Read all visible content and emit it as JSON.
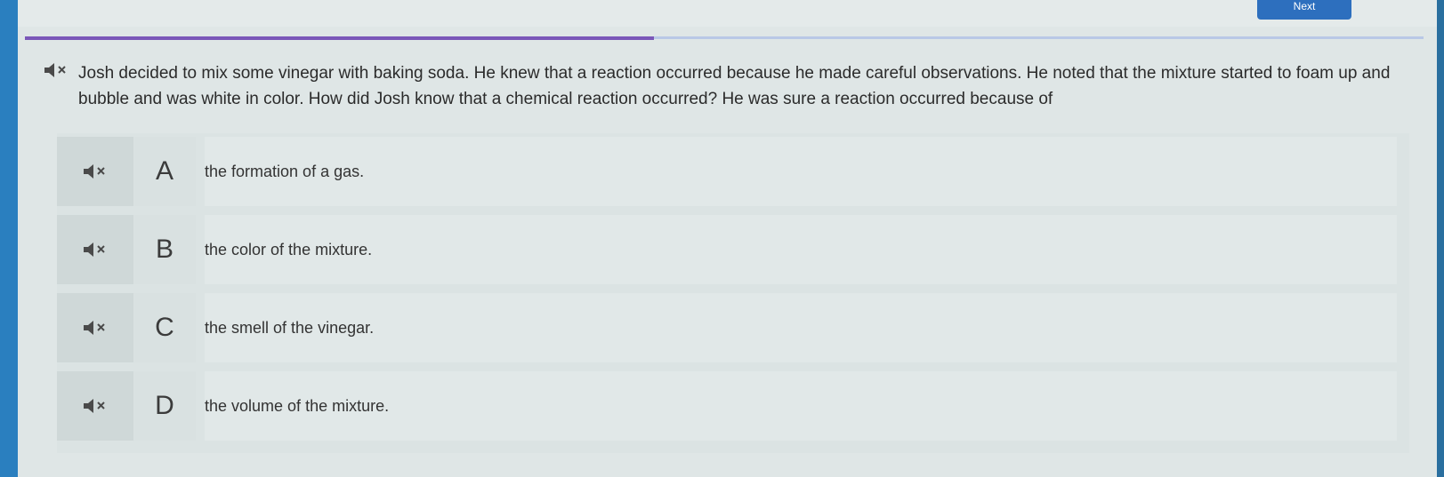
{
  "header": {
    "next_label": "Next",
    "top_right_label": "",
    "top_left_label": ""
  },
  "progress": {
    "percent": 45
  },
  "question": {
    "text": "Josh decided to mix some vinegar with baking soda. He knew that a reaction occurred because he made careful observations. He noted that the mixture started to foam up and bubble and was white in color. How did Josh know that a chemical reaction occurred? He was sure a reaction occurred because of",
    "icon": "speaker-muted-icon"
  },
  "answers": [
    {
      "letter": "A",
      "text": "the formation of a gas."
    },
    {
      "letter": "B",
      "text": "the color of the mixture."
    },
    {
      "letter": "C",
      "text": "the smell of the vinegar."
    },
    {
      "letter": "D",
      "text": "the volume of the mixture."
    }
  ],
  "colors": {
    "accent": "#2d6fbe",
    "progress_fill": "#7a57b8",
    "progress_track": "#b9c8e6",
    "background": "#dfe6e6"
  }
}
